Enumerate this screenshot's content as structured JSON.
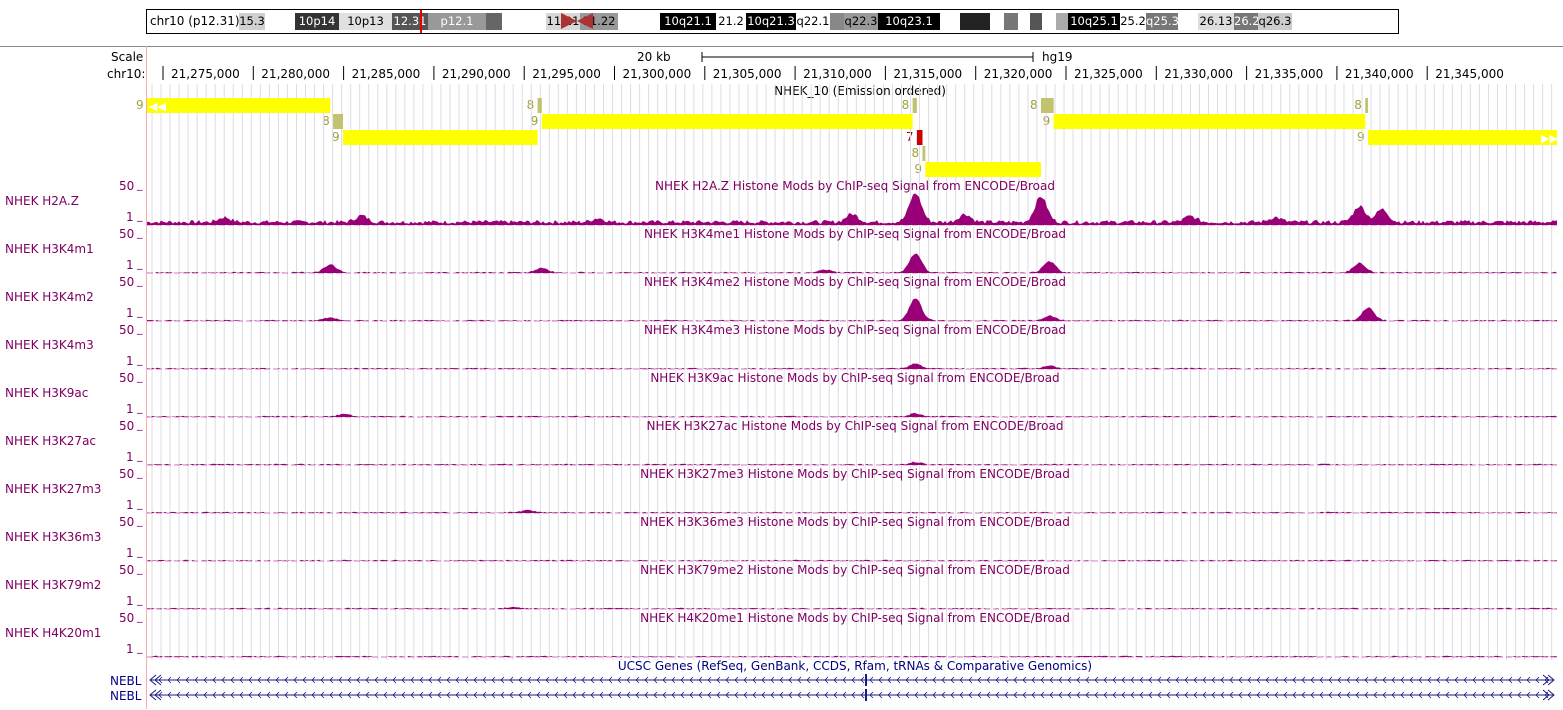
{
  "ideogram": {
    "label": "chr10 (p12.31)",
    "bands": [
      {
        "name": "15.3",
        "color": "#d0d0d0",
        "text": "#000"
      },
      {
        "name": "",
        "color": "#fff",
        "text": "#000"
      },
      {
        "name": "10p14",
        "color": "#333",
        "text": "#fff"
      },
      {
        "name": "10p13",
        "color": "#e0e0e0",
        "text": "#000"
      },
      {
        "name": "12.31",
        "color": "#555",
        "text": "#fff"
      },
      {
        "name": "p12.1",
        "color": "#999",
        "text": "#fff"
      },
      {
        "name": "",
        "color": "#666",
        "text": "#fff"
      },
      {
        "name": "",
        "color": "#fff",
        "text": "#000"
      },
      {
        "name": "",
        "color": "#fff",
        "text": "#000"
      },
      {
        "name": "11.21",
        "color": "#d8d8d8",
        "text": "#000"
      },
      {
        "name": "11.22",
        "color": "#999",
        "text": "#000"
      },
      {
        "name": "",
        "color": "#fff",
        "text": "#000"
      },
      {
        "name": "10q21.1",
        "color": "#000",
        "text": "#fff"
      },
      {
        "name": "21.2",
        "color": "#fff",
        "text": "#000"
      },
      {
        "name": "10q21.3",
        "color": "#000",
        "text": "#fff"
      },
      {
        "name": "q22.1",
        "color": "#fff",
        "text": "#000"
      },
      {
        "name": "",
        "color": "#888",
        "text": "#000"
      },
      {
        "name": "q22.3",
        "color": "#999",
        "text": "#000"
      },
      {
        "name": "10q23.1",
        "color": "#000",
        "text": "#fff"
      },
      {
        "name": "",
        "color": "#fff",
        "text": "#000"
      },
      {
        "name": "",
        "color": "#222",
        "text": "#fff"
      },
      {
        "name": "",
        "color": "#fff",
        "text": "#000"
      },
      {
        "name": "",
        "color": "#777",
        "text": "#fff"
      },
      {
        "name": "",
        "color": "#fff",
        "text": "#000"
      },
      {
        "name": "",
        "color": "#555",
        "text": "#fff"
      },
      {
        "name": "",
        "color": "#fff",
        "text": "#000"
      },
      {
        "name": "",
        "color": "#aaa",
        "text": "#000"
      },
      {
        "name": "10q25.1",
        "color": "#000",
        "text": "#fff"
      },
      {
        "name": "25.2",
        "color": "#fff",
        "text": "#000"
      },
      {
        "name": "q25.3",
        "color": "#777",
        "text": "#fff"
      },
      {
        "name": "",
        "color": "#fff",
        "text": "#000"
      },
      {
        "name": "26.13",
        "color": "#ddd",
        "text": "#000"
      },
      {
        "name": "26.2",
        "color": "#777",
        "text": "#fff"
      },
      {
        "name": "q26.3",
        "color": "#ccc",
        "text": "#000"
      }
    ]
  },
  "scale": {
    "label": "Scale",
    "chrom_label": "chr10:",
    "bar_label": "20 kb",
    "assembly": "hg19",
    "ticks": [
      "21,275,000",
      "21,280,000",
      "21,285,000",
      "21,290,000",
      "21,295,000",
      "21,300,000",
      "21,305,000",
      "21,310,000",
      "21,315,000",
      "21,320,000",
      "21,325,000",
      "21,330,000",
      "21,335,000",
      "21,340,000",
      "21,345,000"
    ]
  },
  "chromhmm": {
    "title": "NHEK_10 (Emission ordered)",
    "states": [
      {
        "row": 0,
        "state": "9",
        "start": 0.0,
        "end": 0.13,
        "color": "#ffff00",
        "arrowLeft": true
      },
      {
        "row": 1,
        "state": "8",
        "start": 0.132,
        "end": 0.139,
        "color": "#c2c270"
      },
      {
        "row": 2,
        "state": "9",
        "start": 0.139,
        "end": 0.277,
        "color": "#ffff00"
      },
      {
        "row": 0,
        "state": "8",
        "start": 0.277,
        "end": 0.28,
        "color": "#c2c270"
      },
      {
        "row": 1,
        "state": "9",
        "start": 0.28,
        "end": 0.543,
        "color": "#ffff00"
      },
      {
        "row": 0,
        "state": "8",
        "start": 0.543,
        "end": 0.546,
        "color": "#c2c270"
      },
      {
        "row": 2,
        "state": "7",
        "start": 0.546,
        "end": 0.55,
        "color": "#cd0000"
      },
      {
        "row": 3,
        "state": "8",
        "start": 0.55,
        "end": 0.552,
        "color": "#c2c270"
      },
      {
        "row": 4,
        "state": "9",
        "start": 0.552,
        "end": 0.634,
        "color": "#ffff00"
      },
      {
        "row": 0,
        "state": "8",
        "start": 0.634,
        "end": 0.643,
        "color": "#c2c270"
      },
      {
        "row": 1,
        "state": "9",
        "start": 0.643,
        "end": 0.864,
        "color": "#ffff00"
      },
      {
        "row": 0,
        "state": "8",
        "start": 0.864,
        "end": 0.866,
        "color": "#c2c270"
      },
      {
        "row": 2,
        "state": "9",
        "start": 0.866,
        "end": 1.0,
        "color": "#ffff00",
        "arrowRight": true
      }
    ]
  },
  "signal_tracks": [
    {
      "label": "NHEK H2A.Z",
      "title": "NHEK H2A.Z Histone Mods by ChIP-seq Signal from ENCODE/Broad",
      "ymax": "50",
      "ymin": "1",
      "peaks": [
        [
          0.545,
          0.9
        ],
        [
          0.634,
          0.8
        ],
        [
          0.86,
          0.5
        ],
        [
          0.876,
          0.4
        ],
        [
          0.152,
          0.2
        ],
        [
          0.055,
          0.15
        ],
        [
          0.58,
          0.25
        ],
        [
          0.5,
          0.25
        ],
        [
          0.74,
          0.18
        ],
        [
          0.32,
          0.12
        ],
        [
          0.8,
          0.15
        ]
      ],
      "base": 0.12
    },
    {
      "label": "NHEK H3K4m1",
      "title": "NHEK H3K4me1 Histone Mods by ChIP-seq Signal from ENCODE/Broad",
      "ymax": "50",
      "ymin": "1",
      "peaks": [
        [
          0.545,
          0.6
        ],
        [
          0.64,
          0.35
        ],
        [
          0.86,
          0.3
        ],
        [
          0.13,
          0.25
        ],
        [
          0.28,
          0.15
        ],
        [
          0.48,
          0.1
        ]
      ],
      "base": 0.03
    },
    {
      "label": "NHEK H3K4m2",
      "title": "NHEK H3K4me2 Histone Mods by ChIP-seq Signal from ENCODE/Broad",
      "ymax": "50",
      "ymin": "1",
      "peaks": [
        [
          0.545,
          0.7
        ],
        [
          0.866,
          0.4
        ],
        [
          0.64,
          0.15
        ],
        [
          0.13,
          0.1
        ]
      ],
      "base": 0.03
    },
    {
      "label": "NHEK H3K4m3",
      "title": "NHEK H3K4me3 Histone Mods by ChIP-seq Signal from ENCODE/Broad",
      "ymax": "50",
      "ymin": "1",
      "peaks": [
        [
          0.545,
          0.15
        ],
        [
          0.64,
          0.1
        ]
      ],
      "base": 0.03
    },
    {
      "label": "NHEK H3K9ac",
      "title": "NHEK H3K9ac Histone Mods by ChIP-seq Signal from ENCODE/Broad",
      "ymax": "50",
      "ymin": "1",
      "peaks": [
        [
          0.545,
          0.1
        ],
        [
          0.14,
          0.08
        ]
      ],
      "base": 0.03
    },
    {
      "label": "NHEK H3K27ac",
      "title": "NHEK H3K27ac Histone Mods by ChIP-seq Signal from ENCODE/Broad",
      "ymax": "50",
      "ymin": "1",
      "peaks": [
        [
          0.545,
          0.08
        ]
      ],
      "base": 0.03
    },
    {
      "label": "NHEK H3K27m3",
      "title": "NHEK H3K27me3 Histone Mods by ChIP-seq Signal from ENCODE/Broad",
      "ymax": "50",
      "ymin": "1",
      "peaks": [
        [
          0.27,
          0.08
        ]
      ],
      "base": 0.03
    },
    {
      "label": "NHEK H3K36m3",
      "title": "NHEK H3K36me3 Histone Mods by ChIP-seq Signal from ENCODE/Broad",
      "ymax": "50",
      "ymin": "1",
      "peaks": [],
      "base": 0.03
    },
    {
      "label": "NHEK H3K79m2",
      "title": "NHEK H3K79me2 Histone Mods by ChIP-seq Signal from ENCODE/Broad",
      "ymax": "50",
      "ymin": "1",
      "peaks": [
        [
          0.26,
          0.06
        ]
      ],
      "base": 0.03
    },
    {
      "label": "NHEK H4K20m1",
      "title": "NHEK H4K20me1 Histone Mods by ChIP-seq Signal from ENCODE/Broad",
      "ymax": "50",
      "ymin": "1",
      "peaks": [],
      "base": 0.03
    }
  ],
  "genes": {
    "title": "UCSC Genes (RefSeq, GenBank, CCDS, Rfam, tRNAs & Comparative Genomics)",
    "items": [
      {
        "label": "NEBL"
      },
      {
        "label": "NEBL"
      }
    ]
  },
  "colors": {
    "signal": "#990077",
    "gene": "#1a1a80",
    "grid": "#dcdce6",
    "label": "#800060"
  }
}
